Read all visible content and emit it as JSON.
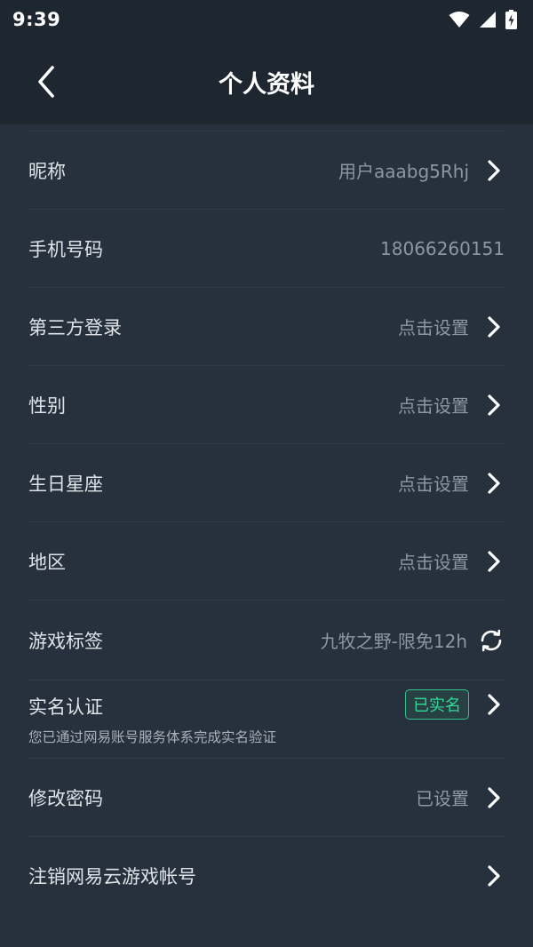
{
  "status_bar": {
    "time": "9:39"
  },
  "header": {
    "title": "个人资料"
  },
  "rows": [
    {
      "label": "昵称",
      "value": "用户aaabg5Rhj"
    },
    {
      "label": "手机号码",
      "value": "18066260151"
    },
    {
      "label": "第三方登录",
      "value": "点击设置"
    },
    {
      "label": "性别",
      "value": "点击设置"
    },
    {
      "label": "生日星座",
      "value": "点击设置"
    },
    {
      "label": "地区",
      "value": "点击设置"
    },
    {
      "label": "游戏标签",
      "value": "九牧之野-限免12h"
    },
    {
      "label": "实名认证",
      "sub_label": "您已通过网易账号服务体系完成实名验证",
      "badge": "已实名"
    },
    {
      "label": "修改密码",
      "value": "已设置"
    },
    {
      "label": "注销网易云游戏帐号"
    }
  ],
  "colors": {
    "background": "#27313d",
    "header_background": "#1e2630",
    "accent_green": "#2fd896",
    "value_gray": "#8d97a3"
  },
  "icons": [
    "back-arrow-icon",
    "wifi-icon",
    "cellular-signal-icon",
    "battery-charging-icon",
    "chevron-right-icon",
    "refresh-icon"
  ]
}
